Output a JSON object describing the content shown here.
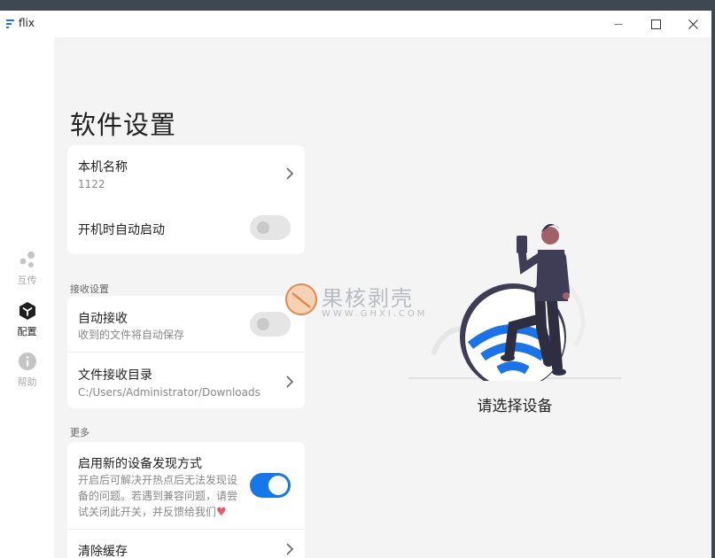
{
  "titlebar": {
    "app_name": "flix",
    "minimize_glyph": "—",
    "maximize_glyph": "☐",
    "close_glyph": "✕"
  },
  "sidebar": {
    "items": [
      {
        "label": "互传",
        "icon": "share-icon",
        "active": false
      },
      {
        "label": "配置",
        "icon": "settings-cube-icon",
        "active": true
      },
      {
        "label": "帮助",
        "icon": "info-icon",
        "active": false
      }
    ]
  },
  "page": {
    "title": "软件设置"
  },
  "sections": {
    "receive_label": "接收设置",
    "more_label": "更多"
  },
  "settings": {
    "device_name": {
      "title": "本机名称",
      "value": "1122"
    },
    "autostart": {
      "title": "开机时自动启动",
      "enabled": false
    },
    "auto_receive": {
      "title": "自动接收",
      "subtitle": "收到的文件将自动保存",
      "enabled": false
    },
    "receive_dir": {
      "title": "文件接收目录",
      "value": "C:/Users/Administrator/Downloads"
    },
    "new_discovery": {
      "title": "启用新的设备发现方式",
      "description_line1": "开启后可解决开热点后无法发现设",
      "description_line2": "备的问题。若遇到兼容问题，请尝",
      "description_line3": "试关闭此开关，并反馈给我们",
      "heart": "♥",
      "enabled": true
    },
    "clear_cache": {
      "title": "清除缓存"
    }
  },
  "empty_state": {
    "hint": "请选择设备",
    "illustration": "person-with-wifi-illustration"
  },
  "watermark": {
    "text": "果核剥壳",
    "sub": "WWW.GHXI.COM"
  },
  "colors": {
    "accent": "#1677e8",
    "background": "#f4f4f4",
    "card": "#ffffff",
    "wifi_blue": "#1a73e8"
  }
}
